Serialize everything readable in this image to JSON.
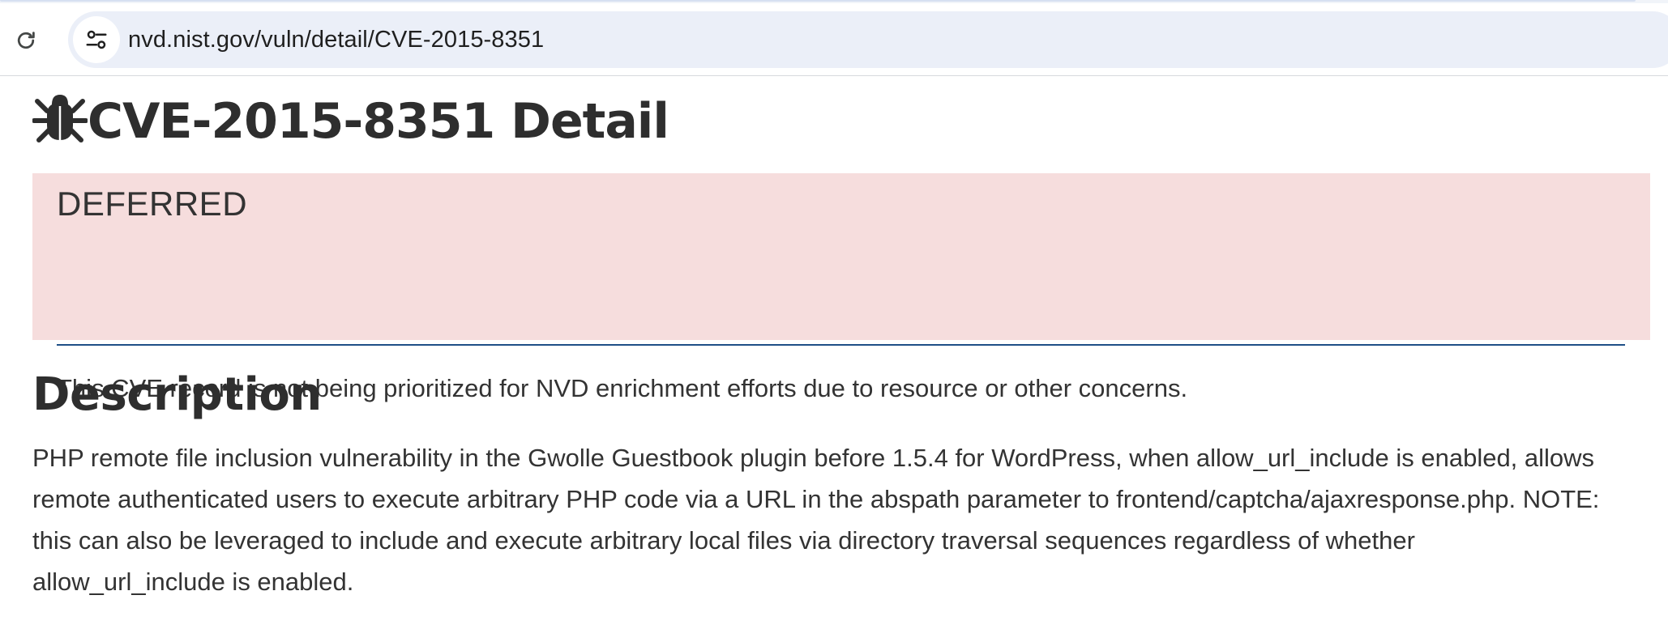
{
  "browser": {
    "url": "nvd.nist.gov/vuln/detail/CVE-2015-8351",
    "reload_icon": "reload-icon",
    "site_info_icon": "tune-icon"
  },
  "page": {
    "title": "CVE-2015-8351 Detail",
    "title_icon": "bug-icon",
    "status": {
      "label": "DEFERRED",
      "message": "This CVE record is not being prioritized for NVD enrichment efforts due to resource or other concerns.",
      "background": "#f6dddd",
      "rule_color": "#1e4f87"
    },
    "description": {
      "heading": "Description",
      "lines": [
        "PHP remote file inclusion vulnerability in the Gwolle Guestbook plugin before 1.5.4 for WordPress, when allow_url_include is enabled, allows",
        "remote authenticated users to execute arbitrary PHP code via a URL in the abspath parameter to frontend/captcha/ajaxresponse.php. NOTE:",
        "this can also be leveraged to include and execute arbitrary local files via directory traversal sequences regardless of whether",
        "allow_url_include is enabled."
      ]
    }
  }
}
